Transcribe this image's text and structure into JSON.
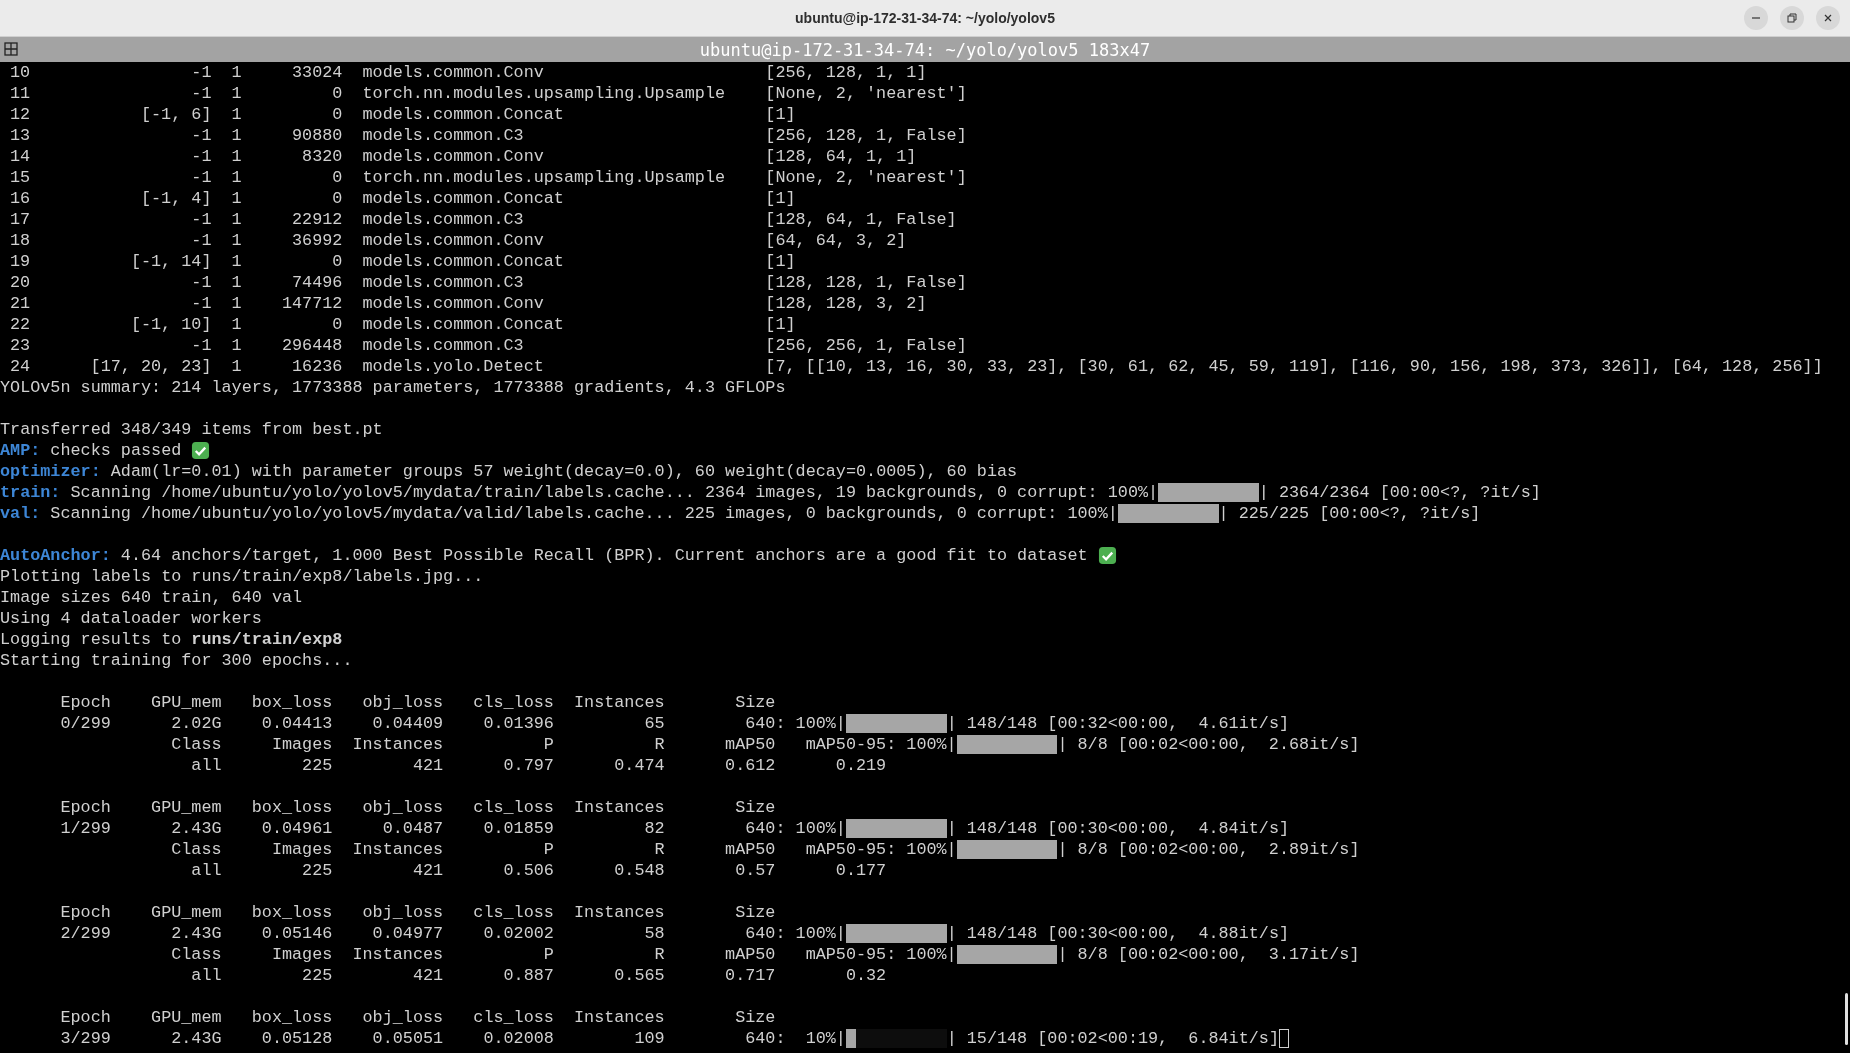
{
  "window": {
    "title": "ubuntu@ip-172-31-34-74: ~/yolo/yolov5"
  },
  "tab": {
    "title": "ubuntu@ip-172-31-34-74: ~/yolo/yolov5 183x47"
  },
  "model_table": {
    "rows": [
      {
        "index": "10",
        "from": "-1",
        "n": "1",
        "params": "33024",
        "module": "models.common.Conv",
        "arguments": "[256, 128, 1, 1]"
      },
      {
        "index": "11",
        "from": "-1",
        "n": "1",
        "params": "0",
        "module": "torch.nn.modules.upsampling.Upsample",
        "arguments": "[None, 2, 'nearest']"
      },
      {
        "index": "12",
        "from": "[-1, 6]",
        "n": "1",
        "params": "0",
        "module": "models.common.Concat",
        "arguments": "[1]"
      },
      {
        "index": "13",
        "from": "-1",
        "n": "1",
        "params": "90880",
        "module": "models.common.C3",
        "arguments": "[256, 128, 1, False]"
      },
      {
        "index": "14",
        "from": "-1",
        "n": "1",
        "params": "8320",
        "module": "models.common.Conv",
        "arguments": "[128, 64, 1, 1]"
      },
      {
        "index": "15",
        "from": "-1",
        "n": "1",
        "params": "0",
        "module": "torch.nn.modules.upsampling.Upsample",
        "arguments": "[None, 2, 'nearest']"
      },
      {
        "index": "16",
        "from": "[-1, 4]",
        "n": "1",
        "params": "0",
        "module": "models.common.Concat",
        "arguments": "[1]"
      },
      {
        "index": "17",
        "from": "-1",
        "n": "1",
        "params": "22912",
        "module": "models.common.C3",
        "arguments": "[128, 64, 1, False]"
      },
      {
        "index": "18",
        "from": "-1",
        "n": "1",
        "params": "36992",
        "module": "models.common.Conv",
        "arguments": "[64, 64, 3, 2]"
      },
      {
        "index": "19",
        "from": "[-1, 14]",
        "n": "1",
        "params": "0",
        "module": "models.common.Concat",
        "arguments": "[1]"
      },
      {
        "index": "20",
        "from": "-1",
        "n": "1",
        "params": "74496",
        "module": "models.common.C3",
        "arguments": "[128, 128, 1, False]"
      },
      {
        "index": "21",
        "from": "-1",
        "n": "1",
        "params": "147712",
        "module": "models.common.Conv",
        "arguments": "[128, 128, 3, 2]"
      },
      {
        "index": "22",
        "from": "[-1, 10]",
        "n": "1",
        "params": "0",
        "module": "models.common.Concat",
        "arguments": "[1]"
      },
      {
        "index": "23",
        "from": "-1",
        "n": "1",
        "params": "296448",
        "module": "models.common.C3",
        "arguments": "[256, 256, 1, False]"
      },
      {
        "index": "24",
        "from": "[17, 20, 23]",
        "n": "1",
        "params": "16236",
        "module": "models.yolo.Detect",
        "arguments": "[7, [[10, 13, 16, 30, 33, 23], [30, 61, 62, 45, 59, 119], [116, 90, 156, 198, 373, 326]], [64, 128, 256]]"
      }
    ]
  },
  "lines": [
    {
      "kind": "text",
      "text": "YOLOv5n summary: 214 layers, 1773388 parameters, 1773388 gradients, 4.3 GFLOPs"
    },
    {
      "kind": "blank"
    },
    {
      "kind": "text",
      "text": "Transferred 348/349 items from best.pt"
    },
    {
      "kind": "labeled",
      "label": "AMP:",
      "text": "checks passed",
      "check": true
    },
    {
      "kind": "labeled",
      "label": "optimizer:",
      "text": "Adam(lr=0.01) with parameter groups 57 weight(decay=0.0), 60 weight(decay=0.0005), 60 bias",
      "check": false
    },
    {
      "kind": "progress",
      "label": "train:",
      "before": "Scanning /home/ubuntu/yolo/yolov5/mydata/train/labels.cache... 2364 images, 19 backgrounds, 0 corrupt: 100%|",
      "level": 1,
      "after": "| 2364/2364 [00:00<?, ?it/s]",
      "cursor": false
    },
    {
      "kind": "progress",
      "label": "val:",
      "before": "Scanning /home/ubuntu/yolo/yolov5/mydata/valid/labels.cache... 225 images, 0 backgrounds, 0 corrupt: 100%|",
      "level": 1,
      "after": "| 225/225 [00:00<?, ?it/s]",
      "cursor": false
    },
    {
      "kind": "blank"
    },
    {
      "kind": "labeled",
      "label": "AutoAnchor:",
      "text": "4.64 anchors/target, 1.000 Best Possible Recall (BPR). Current anchors are a good fit to dataset",
      "check": true
    },
    {
      "kind": "text",
      "text": "Plotting labels to runs/train/exp8/labels.jpg..."
    },
    {
      "kind": "text",
      "text": "Image sizes 640 train, 640 val"
    },
    {
      "kind": "text",
      "text": "Using 4 dataloader workers"
    },
    {
      "kind": "text",
      "text": "Logging results to **runs/train/exp8**"
    },
    {
      "kind": "text",
      "text": "Starting training for 300 epochs..."
    },
    {
      "kind": "blank"
    },
    {
      "kind": "text",
      "text": "      Epoch    GPU_mem   box_loss   obj_loss   cls_loss  Instances       Size"
    },
    {
      "kind": "progress",
      "before": "      0/299      2.02G    0.04413    0.04409    0.01396         65        640: 100%|",
      "level": 1,
      "after": "| 148/148 [00:32<00:00,  4.61it/s]",
      "cursor": false
    },
    {
      "kind": "progress",
      "before": "                 Class     Images  Instances          P          R      mAP50   mAP50-95: 100%|",
      "level": 1,
      "after": "| 8/8 [00:02<00:00,  2.68it/s]",
      "cursor": false
    },
    {
      "kind": "text",
      "text": "                   all        225        421      0.797      0.474      0.612      0.219"
    },
    {
      "kind": "blank"
    },
    {
      "kind": "text",
      "text": "      Epoch    GPU_mem   box_loss   obj_loss   cls_loss  Instances       Size"
    },
    {
      "kind": "progress",
      "before": "      1/299      2.43G    0.04961     0.0487    0.01859         82        640: 100%|",
      "level": 1,
      "after": "| 148/148 [00:30<00:00,  4.84it/s]",
      "cursor": false
    },
    {
      "kind": "progress",
      "before": "                 Class     Images  Instances          P          R      mAP50   mAP50-95: 100%|",
      "level": 1,
      "after": "| 8/8 [00:02<00:00,  2.89it/s]",
      "cursor": false
    },
    {
      "kind": "text",
      "text": "                   all        225        421      0.506      0.548       0.57      0.177"
    },
    {
      "kind": "blank"
    },
    {
      "kind": "text",
      "text": "      Epoch    GPU_mem   box_loss   obj_loss   cls_loss  Instances       Size"
    },
    {
      "kind": "progress",
      "before": "      2/299      2.43G    0.05146    0.04977    0.02002         58        640: 100%|",
      "level": 1,
      "after": "| 148/148 [00:30<00:00,  4.88it/s]",
      "cursor": false
    },
    {
      "kind": "progress",
      "before": "                 Class     Images  Instances          P          R      mAP50   mAP50-95: 100%|",
      "level": 1,
      "after": "| 8/8 [00:02<00:00,  3.17it/s]",
      "cursor": false
    },
    {
      "kind": "text",
      "text": "                   all        225        421      0.887      0.565      0.717       0.32"
    },
    {
      "kind": "blank"
    },
    {
      "kind": "text",
      "text": "      Epoch    GPU_mem   box_loss   obj_loss   cls_loss  Instances       Size"
    },
    {
      "kind": "progress",
      "before": "      3/299      2.43G    0.05128    0.05051    0.02008        109        640:  10%|",
      "level": 0.1,
      "after": "| 15/148 [00:02<00:19,  6.84it/s]",
      "cursor": true
    }
  ]
}
